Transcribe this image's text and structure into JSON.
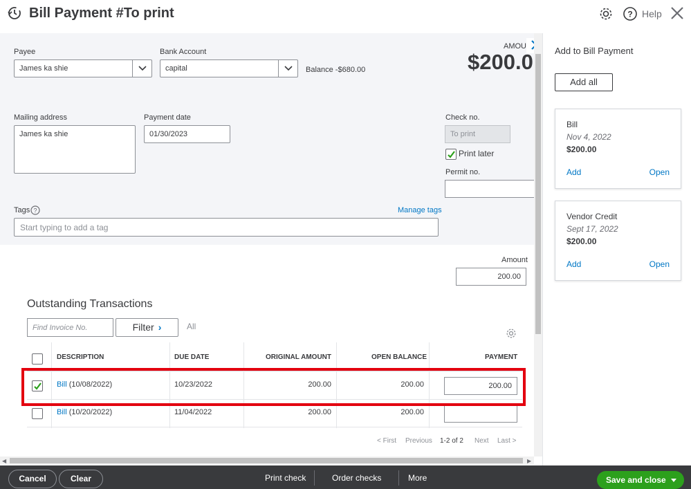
{
  "header": {
    "title": "Bill Payment #To print",
    "help_label": "Help"
  },
  "form": {
    "payee_label": "Payee",
    "payee_value": "James ka shie",
    "bank_label": "Bank Account",
    "bank_value": "capital",
    "balance_text": "Balance -$680.00",
    "amount_caption": "AMOU",
    "amount_big": "$200.0",
    "mailing_label": "Mailing address",
    "mailing_value": "James ka shie",
    "payment_date_label": "Payment date",
    "payment_date_value": "01/30/2023",
    "check_no_label": "Check no.",
    "check_no_value": "To print",
    "print_later_label": "Print later",
    "print_later_checked": true,
    "permit_label": "Permit no.",
    "tags_label": "Tags",
    "manage_tags": "Manage tags",
    "tag_placeholder": "Start typing to add a tag",
    "amount_label": "Amount",
    "amount_value": "200.00"
  },
  "outstanding": {
    "title": "Outstanding Transactions",
    "find_placeholder": "Find Invoice No.",
    "filter_label": "Filter",
    "all_label": "All",
    "columns": [
      "DESCRIPTION",
      "DUE DATE",
      "ORIGINAL AMOUNT",
      "OPEN BALANCE",
      "PAYMENT"
    ],
    "rows": [
      {
        "link": "Bill",
        "desc": " (10/08/2022)",
        "due": "10/23/2022",
        "original": "200.00",
        "open": "200.00",
        "payment": "200.00",
        "checked": true
      },
      {
        "link": "Bill",
        "desc": " (10/20/2022)",
        "due": "11/04/2022",
        "original": "200.00",
        "open": "200.00",
        "payment": "",
        "checked": false
      }
    ],
    "pager": {
      "first": "< First",
      "previous": "Previous",
      "range": "1-2 of 2",
      "next": "Next",
      "last": "Last >"
    }
  },
  "right_panel": {
    "title": "Add to Bill Payment",
    "add_all": "Add all",
    "cards": [
      {
        "type": "Bill",
        "date": "Nov 4, 2022",
        "amount": "$200.00",
        "add": "Add",
        "open": "Open"
      },
      {
        "type": "Vendor Credit",
        "date": "Sept 17, 2022",
        "amount": "$200.00",
        "add": "Add",
        "open": "Open"
      }
    ]
  },
  "footer": {
    "cancel": "Cancel",
    "clear": "Clear",
    "print_check": "Print check",
    "order_checks": "Order checks",
    "more": "More",
    "save_close": "Save and close"
  },
  "colors": {
    "link": "#0077c5",
    "save_green": "#2ca01c",
    "highlight_red": "#e3000f",
    "footer_bg": "#393a3d",
    "form_bg": "#f4f5f8"
  },
  "icons": [
    "history-icon",
    "gear-icon",
    "help-icon",
    "close-icon",
    "chevron-down-icon",
    "chevron-right-icon",
    "checkmark-icon",
    "question-circle-icon",
    "caret-down-icon"
  ]
}
